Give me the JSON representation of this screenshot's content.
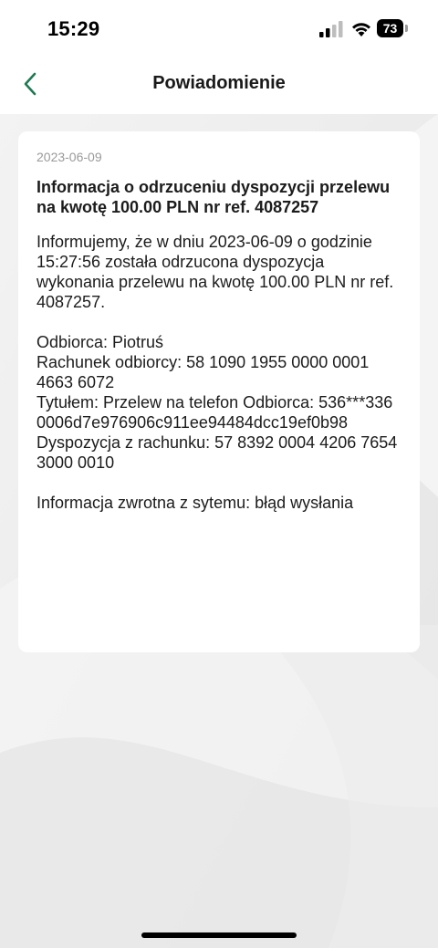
{
  "status_bar": {
    "time": "15:29",
    "battery": "73",
    "icons": [
      "signal-icon",
      "wifi-icon",
      "battery-icon"
    ]
  },
  "nav": {
    "title": "Powiadomienie",
    "back_icon": "chevron-left-icon",
    "accent_color": "#1e7a52"
  },
  "notification": {
    "date": "2023-06-09",
    "title": "Informacja o odrzuceniu dyspozycji przelewu na kwotę 100.00 PLN nr ref. 4087257",
    "intro": "Informujemy, że w dniu 2023-06-09 o godzinie 15:27:56 została odrzucona dyspozycja wykonania przelewu na kwotę 100.00 PLN nr ref. 4087257.",
    "details": [
      "Odbiorca: Piotruś",
      "Rachunek odbiorcy: 58 1090 1955 0000 0001 4663 6072",
      "Tytułem: Przelew na telefon Odbiorca: 536***336 0006d7e976906c911ee94484dcc19ef0b98",
      "Dyspozycja z rachunku: 57 8392 0004 4206 7654 3000 0010"
    ],
    "feedback": "Informacja zwrotna z sytemu: błąd wysłania"
  }
}
